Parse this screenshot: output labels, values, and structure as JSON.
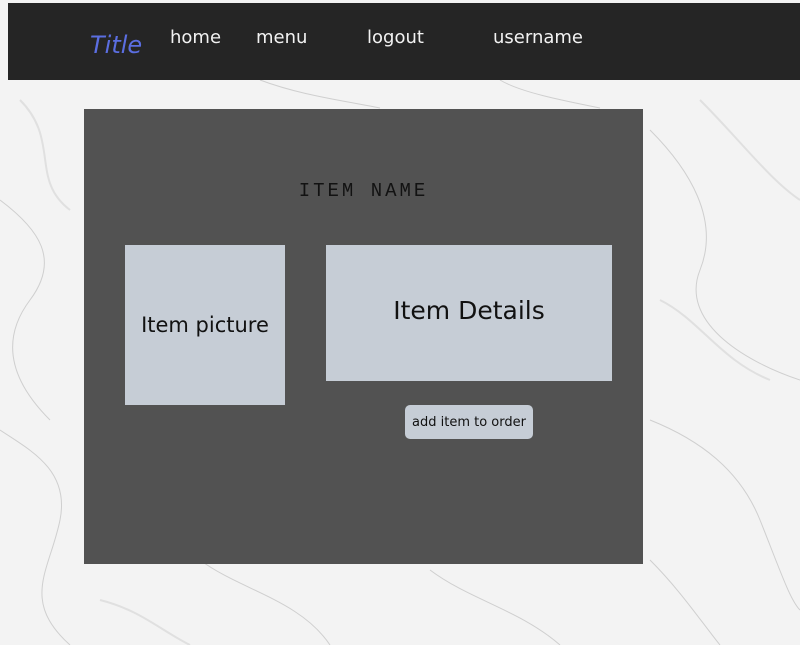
{
  "navbar": {
    "brand": "Title",
    "links": [
      "home",
      "menu",
      "logout",
      "username"
    ]
  },
  "item": {
    "name": "ITEM NAME",
    "picture_placeholder": "Item picture",
    "details_placeholder": "Item Details",
    "add_button_label": "add item to order"
  },
  "colors": {
    "navbar_bg": "#252525",
    "brand": "#5b6ee1",
    "panel_bg": "#525252",
    "box_bg": "#c6cdd6"
  }
}
